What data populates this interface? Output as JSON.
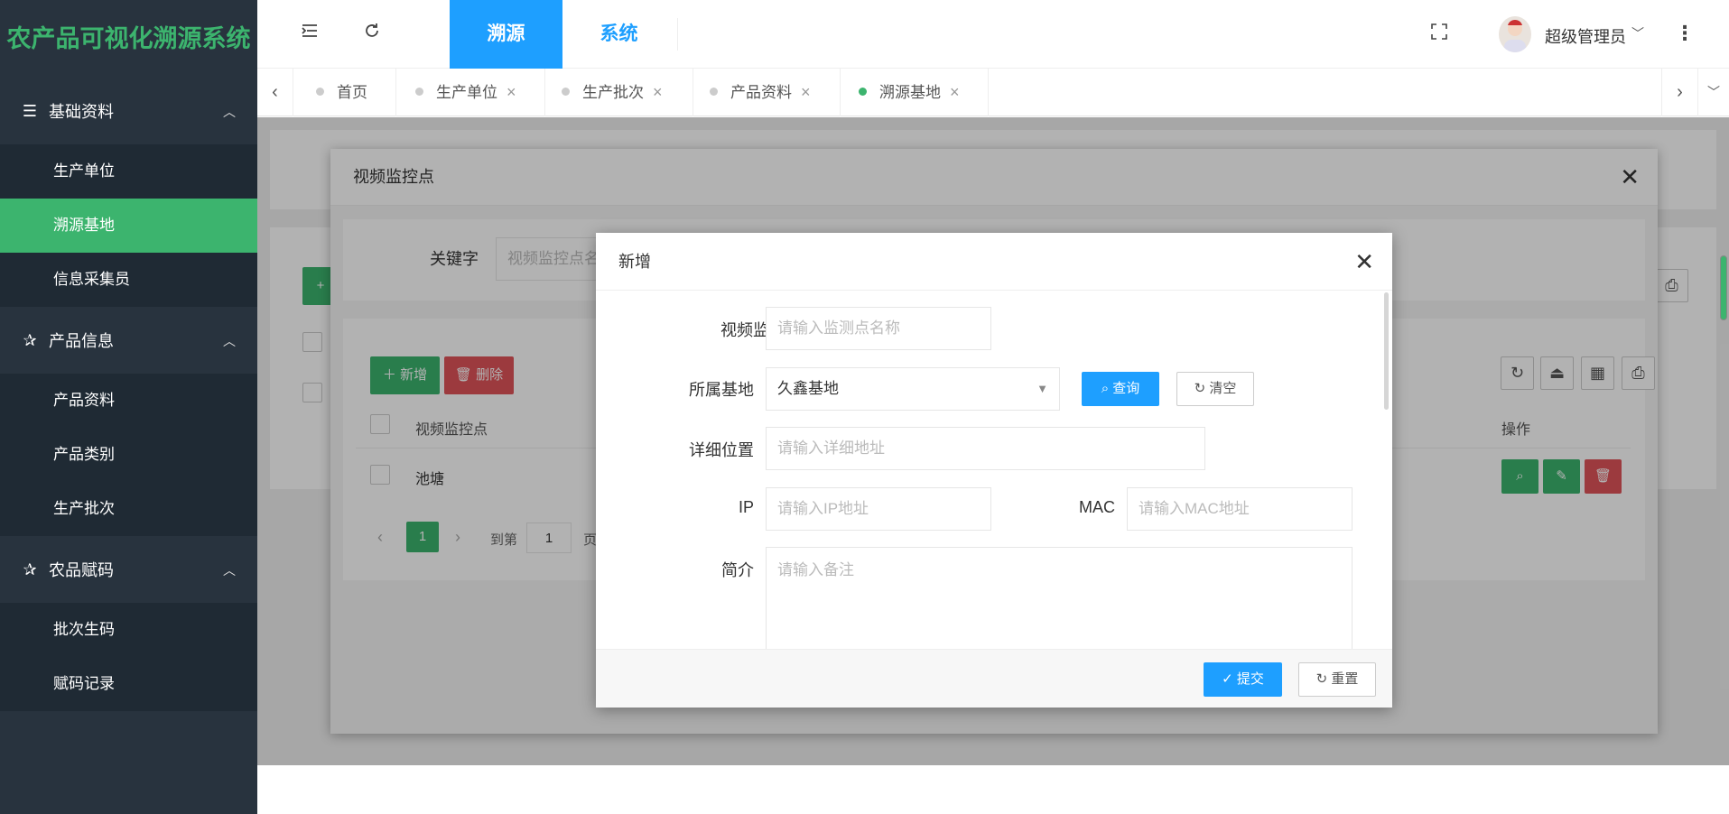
{
  "app": {
    "title": "农产品可视化溯源系统"
  },
  "sidebar": {
    "groups": [
      {
        "label": "基础资料",
        "items": [
          "生产单位",
          "溯源基地",
          "信息采集员"
        ]
      },
      {
        "label": "产品信息",
        "items": [
          "产品资料",
          "产品类别",
          "生产批次"
        ]
      },
      {
        "label": "农品赋码",
        "items": [
          "批次生码",
          "赋码记录"
        ]
      }
    ],
    "active_item": "溯源基地"
  },
  "topbar": {
    "tabs": [
      "溯源",
      "系统"
    ],
    "user_name": "超级管理员"
  },
  "nav_tabs": [
    "首页",
    "生产单位",
    "生产批次",
    "产品资料",
    "溯源基地"
  ],
  "dialog1": {
    "title": "视频监控点",
    "keyword_label": "关键字",
    "keyword_placeholder": "视频监控点名",
    "add_button": "新增",
    "delete_button": "删除",
    "columns": [
      "视频监控点",
      "操作"
    ],
    "rows": [
      {
        "name": "池塘"
      }
    ],
    "pagination": {
      "current_page": "1",
      "goto_label": "到第",
      "goto_value": "1",
      "page_suffix": "页"
    },
    "bg_add_button_fragment": "+"
  },
  "dialog2": {
    "title": "新增",
    "fields": {
      "monitor_point": {
        "label": "视频监控点",
        "placeholder": "请输入监测点名称",
        "required_mark": "*"
      },
      "base": {
        "label": "所属基地",
        "value": "久鑫基地"
      },
      "location": {
        "label": "详细位置",
        "placeholder": "请输入详细地址"
      },
      "ip": {
        "label": "IP",
        "placeholder": "请输入IP地址"
      },
      "mac": {
        "label": "MAC",
        "placeholder": "请输入MAC地址"
      },
      "intro": {
        "label": "简介",
        "placeholder": "请输入备注"
      }
    },
    "query_button": "查询",
    "clear_button": "清空",
    "submit_button": "提交",
    "reset_button": "重置"
  },
  "colors": {
    "brand_green": "#3cb46e",
    "sidebar_bg": "#28333e",
    "primary_blue": "#1e9fff",
    "danger_red": "#e0545a"
  },
  "icons": [
    "menu-fold-icon",
    "refresh-icon",
    "fullscreen-icon",
    "more-icon",
    "search-icon",
    "close-icon"
  ]
}
